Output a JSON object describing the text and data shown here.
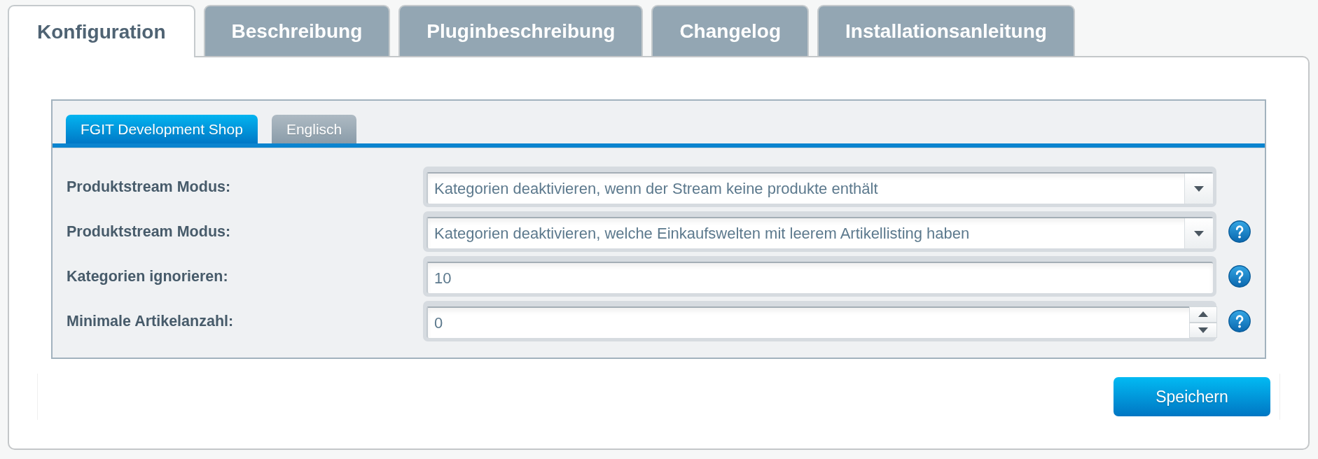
{
  "tabs": [
    {
      "label": "Konfiguration",
      "selected": true
    },
    {
      "label": "Beschreibung",
      "selected": false
    },
    {
      "label": "Pluginbeschreibung",
      "selected": false
    },
    {
      "label": "Changelog",
      "selected": false
    },
    {
      "label": "Installationsanleitung",
      "selected": false
    }
  ],
  "shop_tabs": [
    {
      "label": "FGIT Development Shop",
      "selected": true
    },
    {
      "label": "Englisch",
      "selected": false
    }
  ],
  "fields": [
    {
      "label": "Produktstream Modus:",
      "kind": "select",
      "value": "Kategorien deaktivieren, wenn der Stream keine produkte enthält",
      "help": false
    },
    {
      "label": "Produktstream Modus:",
      "kind": "select",
      "value": "Kategorien deaktivieren, welche Einkaufswelten mit leerem Artikellisting haben",
      "help": true
    },
    {
      "label": "Kategorien ignorieren:",
      "kind": "text",
      "value": "10",
      "help": true
    },
    {
      "label": "Minimale Artikelanzahl:",
      "kind": "number",
      "value": "0",
      "help": true
    }
  ],
  "save_button": {
    "label": "Speichern"
  }
}
